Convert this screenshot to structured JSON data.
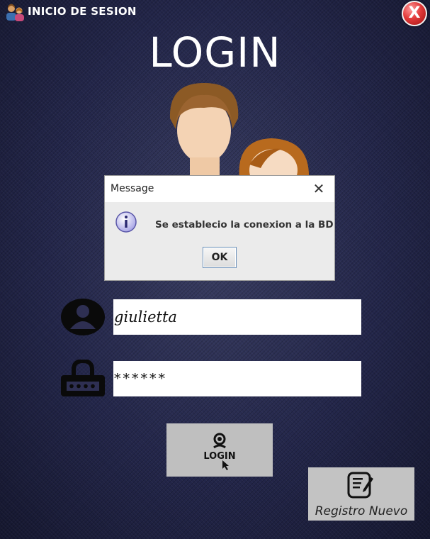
{
  "window": {
    "title": "INICIO DE SESION",
    "close_symbol": "X",
    "icon": "users-icon"
  },
  "heading": "LOGIN",
  "illustration": {
    "icon": "users-illustration"
  },
  "dialog": {
    "title": "Message",
    "close_symbol": "✕",
    "message": "Se establecio la conexion a la BD",
    "ok_label": "OK",
    "icon": "info-icon"
  },
  "form": {
    "username_value": "giulietta",
    "password_value": "******",
    "username_icon": "user-icon",
    "password_icon": "lock-icon"
  },
  "buttons": {
    "login_icon_text": "LOGIN",
    "registro_label": "Registro Nuevo"
  },
  "colors": {
    "close_red": "#e23a3a",
    "button_gray": "#bfbfbf",
    "background": "#23264a"
  }
}
